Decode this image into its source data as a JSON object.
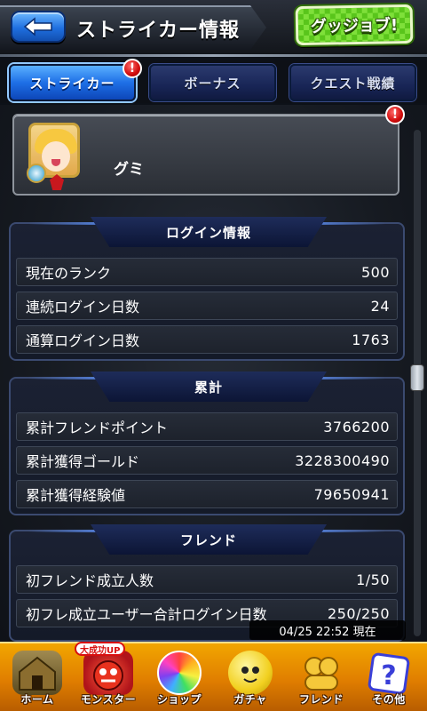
{
  "header": {
    "title": "ストライカー情報",
    "guggy_button_label": "グッジョブ!",
    "back_icon": "back-arrow-icon"
  },
  "tabs": [
    {
      "label": "ストライカー",
      "active": true,
      "has_alert": true
    },
    {
      "label": "ボーナス",
      "active": false,
      "has_alert": false
    },
    {
      "label": "クエスト戦績",
      "active": false,
      "has_alert": false
    }
  ],
  "alert_mark": "!",
  "profile": {
    "name": "グミ",
    "has_alert": true
  },
  "sections": {
    "login": {
      "title": "ログイン情報",
      "rows": [
        {
          "label": "現在のランク",
          "value": "500"
        },
        {
          "label": "連続ログイン日数",
          "value": "24"
        },
        {
          "label": "通算ログイン日数",
          "value": "1763"
        }
      ]
    },
    "totals": {
      "title": "累計",
      "rows": [
        {
          "label": "累計フレンドポイント",
          "value": "3766200"
        },
        {
          "label": "累計獲得ゴールド",
          "value": "3228300490"
        },
        {
          "label": "累計獲得経験値",
          "value": "79650941"
        }
      ]
    },
    "friend": {
      "title": "フレンド",
      "rows": [
        {
          "label": "初フレンド成立人数",
          "value": "1/50"
        },
        {
          "label": "初フレ成立ユーザー合計ログイン日数",
          "value": "250/250"
        }
      ]
    }
  },
  "timestamp": "04/25 22:52 現在",
  "bottom_nav": [
    {
      "label": "ホーム",
      "icon": "home-icon",
      "color": "#7a6a3a"
    },
    {
      "label": "モンスター",
      "icon": "monster-icon",
      "color": "#d0323a",
      "bubble": "大成功UP"
    },
    {
      "label": "ショップ",
      "icon": "orb-icon",
      "color": "#8a5cf0"
    },
    {
      "label": "ガチャ",
      "icon": "gacha-icon",
      "color": "#f2d020"
    },
    {
      "label": "フレンド",
      "icon": "friend-icon",
      "color": "#f5c83a"
    },
    {
      "label": "その他",
      "icon": "other-icon",
      "color": "#3a3fd8"
    }
  ],
  "colors": {
    "accent_blue": "#1e6fe6",
    "alert_red": "#d10c0c",
    "nav_orange": "#e07e00",
    "guggy_green": "#59c51b"
  }
}
